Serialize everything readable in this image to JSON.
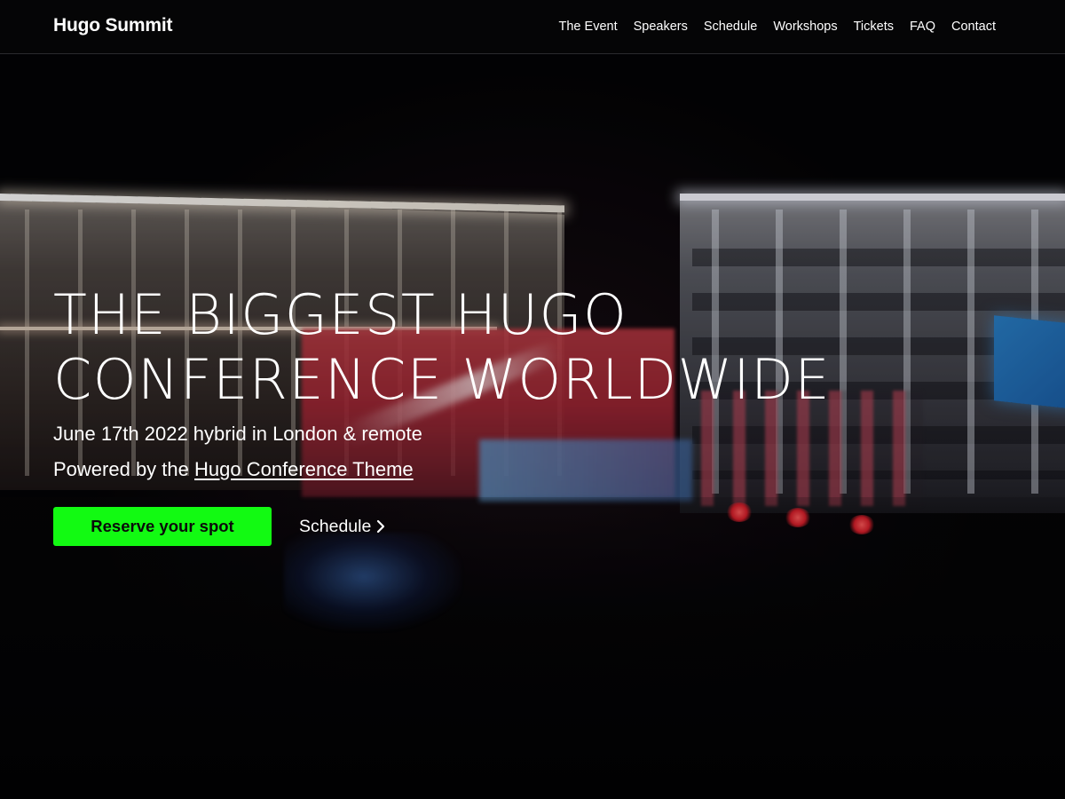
{
  "header": {
    "brand": "Hugo Summit",
    "nav_items": [
      {
        "label": "The Event"
      },
      {
        "label": "Speakers"
      },
      {
        "label": "Schedule"
      },
      {
        "label": "Workshops"
      },
      {
        "label": "Tickets"
      },
      {
        "label": "FAQ"
      },
      {
        "label": "Contact"
      }
    ]
  },
  "hero": {
    "title_line1": "THE BIGGEST HUGO",
    "title_line2": "CONFERENCE WORLDWIDE",
    "date_text": "June 17th 2022 hybrid in London & remote",
    "powered_prefix": "Powered by the",
    "powered_link": "Hugo Conference Theme",
    "cta_primary": "Reserve your spot",
    "cta_secondary": "Schedule",
    "cta_secondary_icon": "chevron-right-icon"
  },
  "colors": {
    "accent": "#12fa12",
    "nav_background": "#050506",
    "text": "#ffffff"
  }
}
